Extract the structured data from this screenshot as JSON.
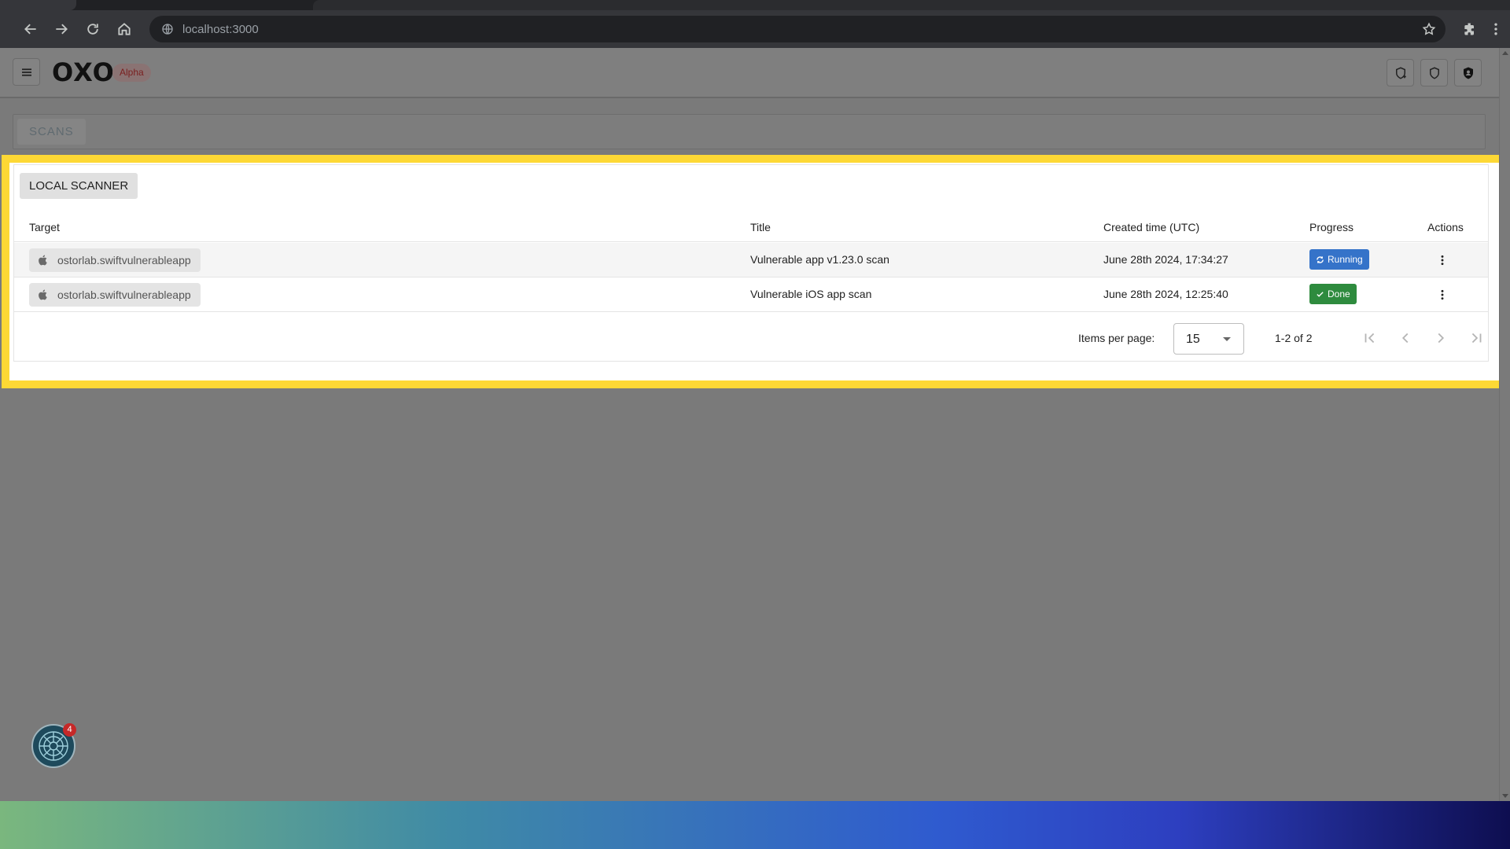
{
  "browser": {
    "url": "localhost:3000"
  },
  "app": {
    "logo": "OXO",
    "badge": "Alpha",
    "scans_tab": "SCANS"
  },
  "card": {
    "scanner_label": "LOCAL SCANNER",
    "columns": {
      "target": "Target",
      "title": "Title",
      "created": "Created time (UTC)",
      "progress": "Progress",
      "actions": "Actions"
    },
    "rows": [
      {
        "target": "ostorlab.swiftvulnerableapp",
        "title": "Vulnerable app v1.23.0 scan",
        "created": "June 28th 2024, 17:34:27",
        "progress": "Running"
      },
      {
        "target": "ostorlab.swiftvulnerableapp",
        "title": "Vulnerable iOS app scan",
        "created": "June 28th 2024, 12:25:40",
        "progress": "Done"
      }
    ],
    "pagination": {
      "items_per_page_label": "Items per page:",
      "items_per_page": "15",
      "range": "1-2 of 2"
    }
  },
  "notifications": {
    "count": "4"
  },
  "colors": {
    "highlight": "#fdd835",
    "running": "#3573c9",
    "done": "#2e8b3e",
    "alpha_badge": "#c62828"
  }
}
